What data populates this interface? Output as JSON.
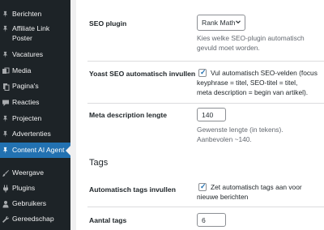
{
  "sidebar": {
    "items": [
      {
        "label": "Berichten",
        "icon": "pin-icon"
      },
      {
        "label": "Affiliate Link",
        "label2": "Poster",
        "icon": "pin-icon"
      },
      {
        "label": "Vacatures",
        "icon": "pin-icon"
      },
      {
        "label": "Media",
        "icon": "media-icon"
      },
      {
        "label": "Pagina's",
        "icon": "pages-icon"
      },
      {
        "label": "Reacties",
        "icon": "comments-icon"
      },
      {
        "label": "Projecten",
        "icon": "pin-icon"
      },
      {
        "label": "Advertenties",
        "icon": "pin-icon"
      },
      {
        "label": "Content AI Agent",
        "icon": "pin-icon",
        "active": true
      },
      {
        "label": "Weergave",
        "icon": "brush-icon"
      },
      {
        "label": "Plugins",
        "icon": "plugin-icon"
      },
      {
        "label": "Gebruikers",
        "icon": "users-icon"
      },
      {
        "label": "Gereedschap",
        "icon": "tools-icon"
      }
    ]
  },
  "settings": {
    "seo_plugin": {
      "label": "SEO plugin",
      "value": "Rank Math",
      "desc_line1": "Kies welke SEO-plugin automatisch",
      "desc_line2": "gevuld moet worden."
    },
    "yoast_auto": {
      "label": "Yoast SEO automatisch invullen",
      "checked": true,
      "text_line1": "Vul automatisch SEO-velden (focus",
      "text_line2": "keyphrase = titel, SEO-titel = titel,",
      "text_line3": "meta description = begin van artikel)."
    },
    "meta_length": {
      "label": "Meta description lengte",
      "value": "140",
      "desc_line1": "Gewenste lengte (in tekens).",
      "desc_line2": "Aanbevolen ~140."
    },
    "tags_section": {
      "title": "Tags"
    },
    "auto_tags": {
      "label": "Automatisch tags invullen",
      "checked": true,
      "text_line1": "Zet automatisch tags aan voor",
      "text_line2": "nieuwe berichten"
    },
    "tag_count": {
      "label": "Aantal tags",
      "value": "6"
    }
  },
  "colors": {
    "sidebar_bg": "#1d2327",
    "active_bg": "#2271b1",
    "checkbox_tick": "#2271b1"
  }
}
